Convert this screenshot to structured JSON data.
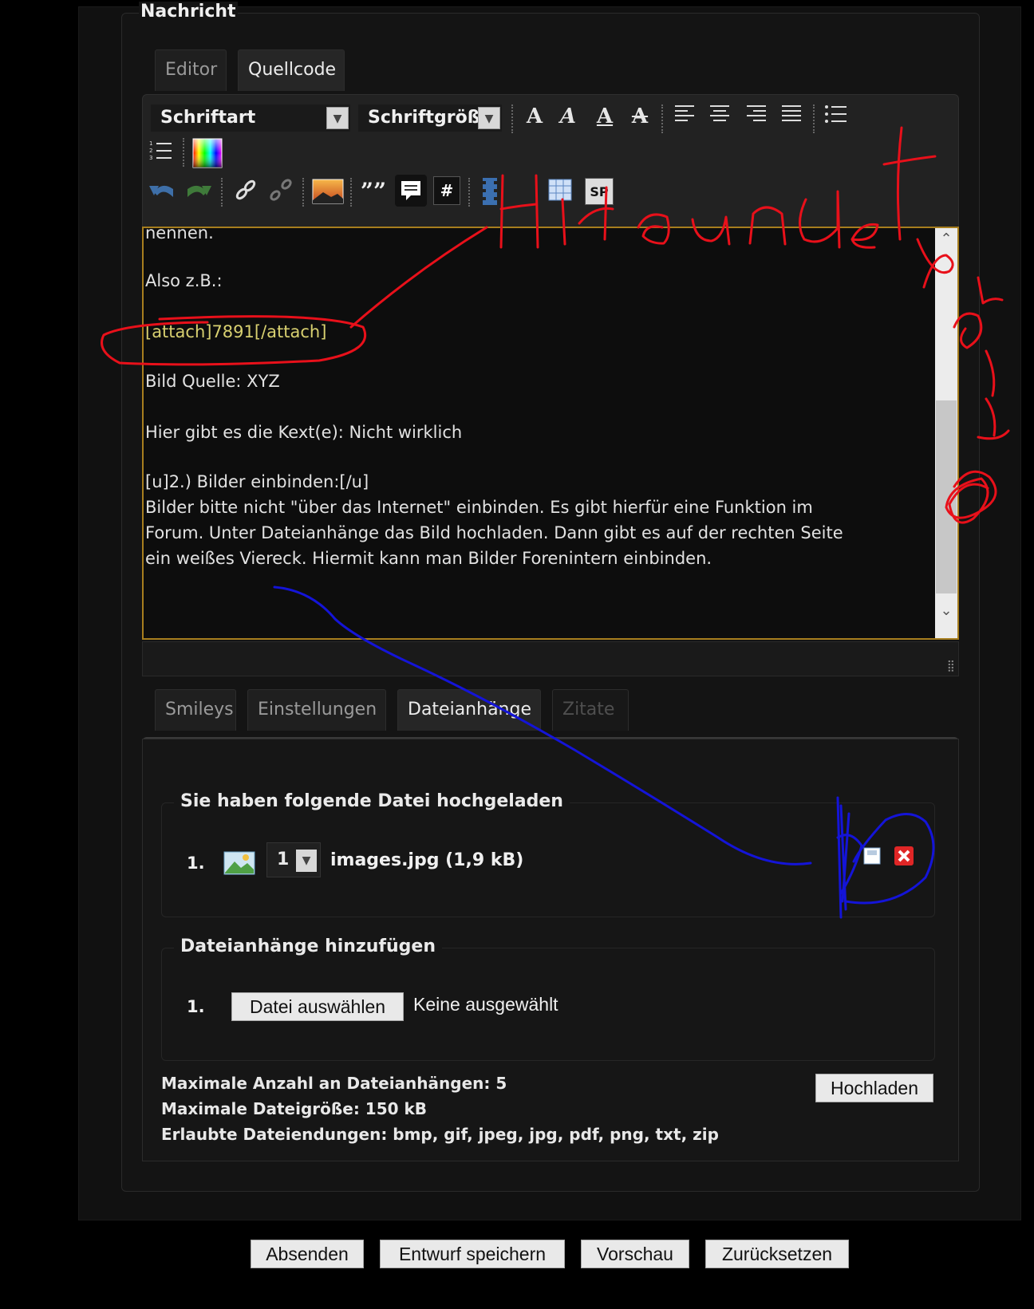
{
  "message_label": "Nachricht",
  "editor_tabs": [
    {
      "label": "Editor"
    },
    {
      "label": "Quellcode"
    }
  ],
  "toolbar": {
    "font_select": "Schriftart",
    "size_select": "Schriftgröße",
    "bold": "A",
    "italic": "A",
    "underline": "A",
    "strike": "A",
    "tag_label": "SP",
    "hash_label": "#",
    "quote_label": "””"
  },
  "editor_lines": [
    "nennen.",
    "Also z.B.:",
    "[attach]7891[/attach]",
    "Bild Quelle: XYZ",
    "Hier gibt es die Kext(e): Nicht wirklich",
    "[u]2.) Bilder einbinden:[/u]",
    "Bilder bitte nicht \"über das Internet\" einbinden. Es gibt hierfür eine Funktion im",
    "Forum. Unter Dateianhänge das Bild hochladen. Dann gibt es auf der rechten Seite",
    "ein weißes Viereck. Hiermit kann man Bilder  Forenintern einbinden."
  ],
  "bottom_tabs": [
    {
      "label": "Smileys"
    },
    {
      "label": "Einstellungen"
    },
    {
      "label": "Dateianhänge"
    },
    {
      "label": "Zitate"
    }
  ],
  "uploaded": {
    "legend": "Sie haben folgende Datei hochgeladen",
    "number": "1.",
    "select_value": "1",
    "filename": "images.jpg (1,9 kB)"
  },
  "add": {
    "legend": "Dateianhänge hinzufügen",
    "number": "1.",
    "choose_label": "Datei auswählen",
    "none_label": "Keine ausgewählt"
  },
  "upload_button": "Hochladen",
  "limits": [
    "Maximale Anzahl an Dateianhängen: 5",
    "Maximale Dateigröße: 150 kB",
    "Erlaubte Dateiendungen: bmp, gif, jpeg, jpg, pdf, png, txt, zip"
  ],
  "actions": {
    "submit": "Absenden",
    "save_draft": "Entwurf speichern",
    "preview": "Vorschau",
    "reset": "Zurücksetzen"
  },
  "colors": {
    "editor_border": "#a77e1e",
    "annotation_red": "#e8101a",
    "annotation_blue": "#1414d8"
  }
}
